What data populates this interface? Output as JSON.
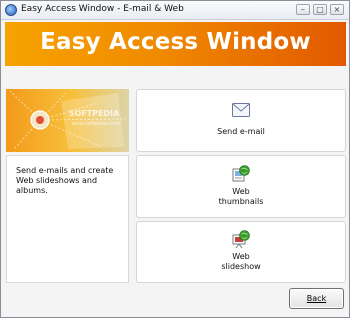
{
  "window": {
    "title": "Easy Access Window - E-mail & Web",
    "controls": {
      "minimize": "–",
      "maximize": "□",
      "close": "×"
    }
  },
  "banner": {
    "title": "Easy Access Window"
  },
  "hero": {
    "watermark": "SOFTPEDIA",
    "watermark_sub": "www.softpedia.com"
  },
  "description": "Send e-mails and create Web slideshows and albums.",
  "tiles": [
    {
      "label": "Send e-mail",
      "icon": "envelope-icon"
    },
    {
      "label_line1": "Web",
      "label_line2": "thumbnails",
      "icon": "web-thumbnails-icon"
    },
    {
      "label_line1": "Web",
      "label_line2": "slideshow",
      "icon": "web-slideshow-icon"
    }
  ],
  "footer": {
    "back_label": "Back"
  },
  "colors": {
    "banner_start": "#f7a300",
    "banner_end": "#e25800"
  }
}
